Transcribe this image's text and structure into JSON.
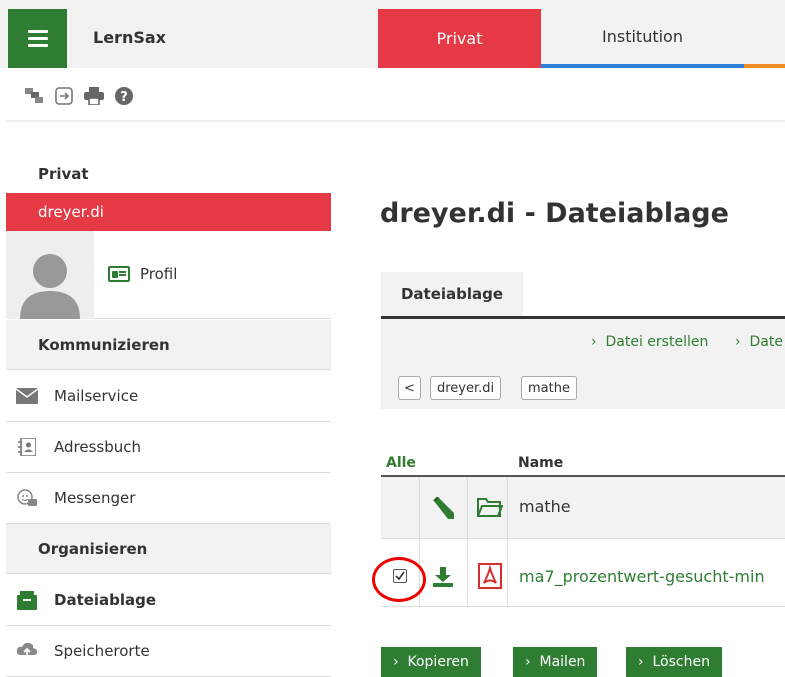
{
  "app": {
    "name": "LernSax"
  },
  "top_tabs": [
    {
      "label": "Privat"
    },
    {
      "label": "Institution"
    }
  ],
  "toolbar": {
    "icons": [
      "switch-window-icon",
      "logout-icon",
      "print-icon",
      "help-icon"
    ]
  },
  "sidebar": {
    "title": "Privat",
    "user": "dreyer.di",
    "profile_label": "Profil",
    "sections": [
      {
        "label": "Kommunizieren",
        "items": [
          {
            "label": "Mailservice",
            "icon": "mail-icon"
          },
          {
            "label": "Adressbuch",
            "icon": "addressbook-icon"
          },
          {
            "label": "Messenger",
            "icon": "messenger-icon"
          }
        ]
      },
      {
        "label": "Organisieren",
        "items": [
          {
            "label": "Dateiablage",
            "icon": "file-storage-icon"
          },
          {
            "label": "Speicherorte",
            "icon": "cloud-storage-icon"
          }
        ]
      }
    ]
  },
  "main": {
    "title": "dreyer.di - Dateiablage",
    "tab": "Dateiablage",
    "actions": [
      "Datei erstellen",
      "Date"
    ],
    "breadcrumb": {
      "back": "<",
      "items": [
        "dreyer.di",
        "mathe"
      ]
    },
    "table": {
      "col_all": "Alle",
      "col_name": "Name",
      "rows": [
        {
          "type": "folder",
          "name": "mathe"
        },
        {
          "type": "pdf",
          "name": "ma7_prozentwert-gesucht-min",
          "checked": true
        }
      ]
    },
    "buttons": [
      "Kopieren",
      "Mailen",
      "Löschen"
    ]
  },
  "colors": {
    "green": "#2e7d32",
    "red": "#e63946",
    "blue": "#2f80d8",
    "orange": "#f28c28"
  }
}
